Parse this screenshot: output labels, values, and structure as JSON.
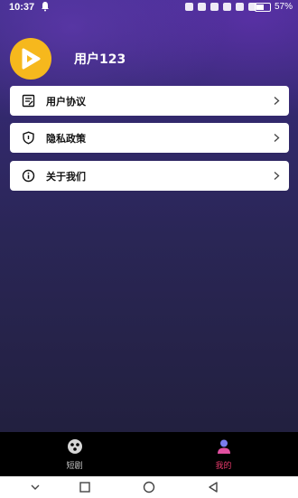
{
  "status": {
    "time": "10:37",
    "battery_percent": "57%",
    "battery_level": 0.57
  },
  "profile": {
    "username": "用户123"
  },
  "menu": [
    {
      "label": "用户协议",
      "icon": "document-icon"
    },
    {
      "label": "隐私政策",
      "icon": "shield-icon"
    },
    {
      "label": "关于我们",
      "icon": "info-icon"
    }
  ],
  "tabs": [
    {
      "label": "短剧",
      "icon": "film-icon",
      "active": false
    },
    {
      "label": "我的",
      "icon": "user-icon",
      "active": true
    }
  ],
  "colors": {
    "accent": "#f6b81d",
    "active_tab": "#e93a6c",
    "inactive_tab": "#c8c8c8"
  }
}
